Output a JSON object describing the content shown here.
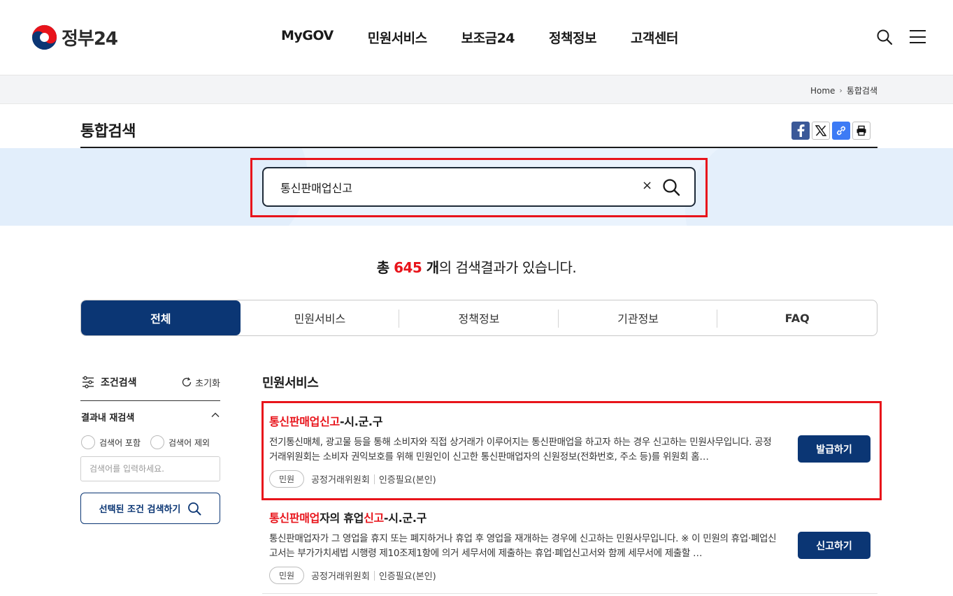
{
  "header": {
    "logo_text": "정부24",
    "nav": [
      "MyGOV",
      "민원서비스",
      "보조금24",
      "정책정보",
      "고객센터"
    ]
  },
  "breadcrumb": {
    "home": "Home",
    "current": "통합검색"
  },
  "page": {
    "title": "통합검색"
  },
  "search": {
    "value": "통신판매업신고",
    "clear": "×"
  },
  "result": {
    "prefix": "총 ",
    "count": "645",
    "unit": " 개",
    "suffix": "의 검색결과가 있습니다."
  },
  "tabs": [
    "전체",
    "민원서비스",
    "정책정보",
    "기관정보",
    "FAQ"
  ],
  "sidebar": {
    "condition_label": "조건검색",
    "reset_label": "초기화",
    "research_label": "결과내 재검색",
    "radio_include": "검색어 포함",
    "radio_exclude": "검색어 제외",
    "input_placeholder": "검색어를 입력하세요.",
    "search_button": "선택된 조건 검색하기"
  },
  "main": {
    "section_title": "민원서비스",
    "items": [
      {
        "title_hl": "통신판매업신고",
        "title_rest": "-시.군.구",
        "desc": "전기통신매체, 광고물 등을 통해 소비자와 직접 상거래가 이루어지는 통신판매업을 하고자 하는 경우 신고하는 민원사무입니다. 공정거래위원회는 소비자 권익보호를 위해 민원인이 신고한 통신판매업자의 신원정보(전화번호, 주소 등)를 위원회 홈…",
        "tag": "민원",
        "org": "공정거래위원회",
        "auth": "인증필요(본인)",
        "button": "발급하기"
      },
      {
        "title_hl1": "통신판매업",
        "title_mid": "자의 휴업",
        "title_hl2": "신고",
        "title_rest": "-시.군.구",
        "desc": "통신판매업자가 그 영업을 휴지 또는 폐지하거나 휴업 후 영업을 재개하는 경우에 신고하는 민원사무입니다. ※ 이 민원의 휴업·폐업신고서는 부가가치세법 시행령 제10조제1항에 의거 세무서에 제출하는 휴업·폐업신고서와 함께 세무서에 제출할 …",
        "tag": "민원",
        "org": "공정거래위원회",
        "auth": "인증필요(본인)",
        "button": "신고하기"
      }
    ]
  },
  "colors": {
    "primary": "#0b3674",
    "highlight": "#e8141b",
    "band": "#eaf3fd"
  }
}
